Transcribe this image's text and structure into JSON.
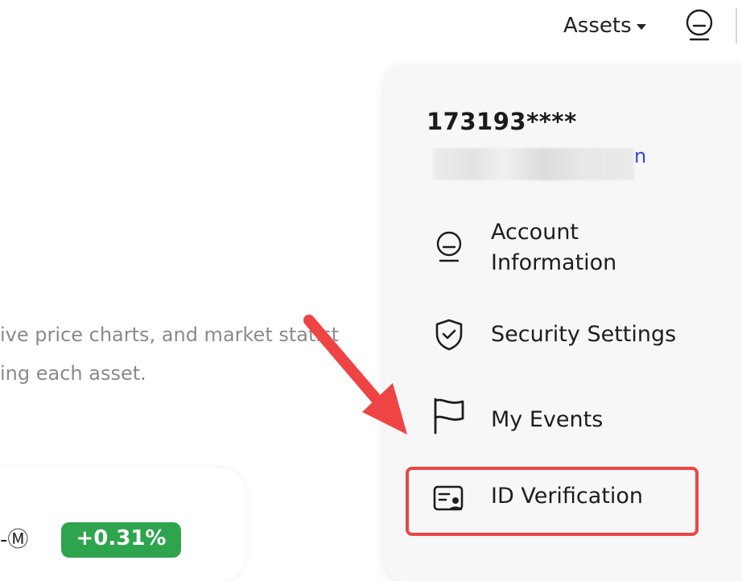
{
  "header": {
    "assets_label": "Assets",
    "icons": {
      "caret": "caret-down-icon",
      "avatar": "user-avatar-icon"
    }
  },
  "background": {
    "description_lines": [
      "ive price charts, and market statist",
      "ing each asset."
    ],
    "asset_card": {
      "ticker_text": "-Ⓜ",
      "change_pct": "+0.31%"
    }
  },
  "account_menu": {
    "user_id": "173193****",
    "email_visible_fragment": "n",
    "items": [
      {
        "label": "Account Information",
        "icon": "user-avatar-icon"
      },
      {
        "label": "Security Settings",
        "icon": "shield-check-icon"
      },
      {
        "label": "My Events",
        "icon": "flag-icon"
      },
      {
        "label": "ID Verification",
        "icon": "id-card-icon"
      }
    ]
  },
  "colors": {
    "highlight_border": "#ef4444",
    "arrow": "#ef4444",
    "positive_change": "#2ea44f",
    "panel_bg": "#f7f7f7",
    "muted_text": "#8a8a8a"
  }
}
